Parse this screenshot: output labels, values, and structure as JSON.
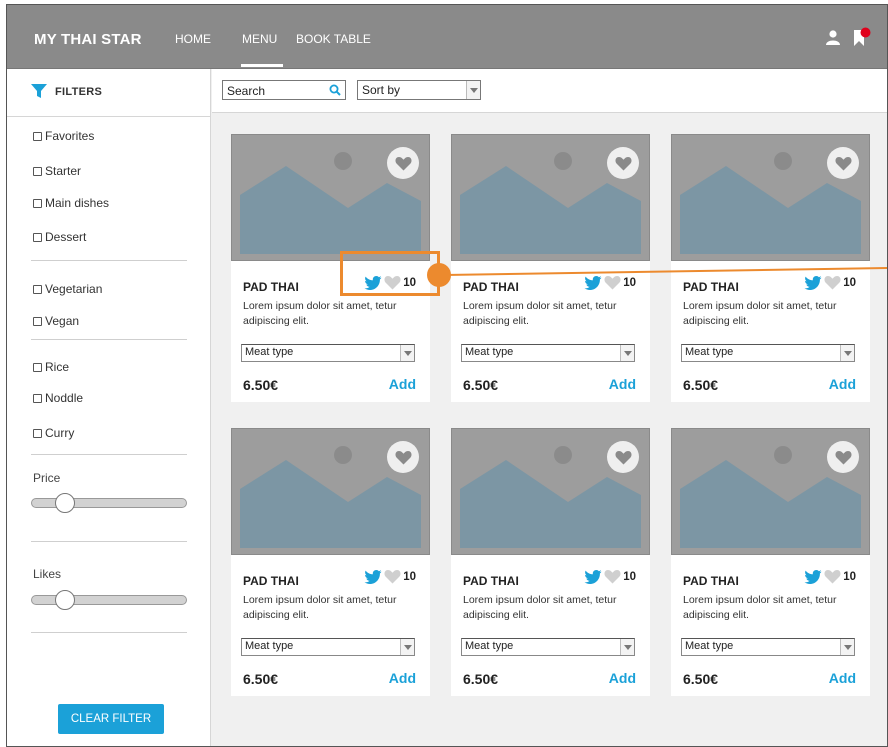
{
  "header": {
    "brand": "MY THAI STAR",
    "nav": [
      "HOME",
      "MENU",
      "BOOK TABLE"
    ],
    "active_nav": "MENU",
    "icons": [
      "user-icon",
      "bookmark-icon"
    ],
    "colors": {
      "header_bg": "#8a8a8a",
      "accent": "#1ba1d8",
      "notification_dot": "#e0001b"
    }
  },
  "sidebar": {
    "filters_title": "FILTERS",
    "groups": [
      [
        "Favorites",
        "Starter",
        "Main dishes",
        "Dessert"
      ],
      [
        "Vegetarian",
        "Vegan"
      ],
      [
        "Rice",
        "Noddle",
        "Curry"
      ]
    ],
    "price_label": "Price",
    "likes_label": "Likes",
    "clear_button": "CLEAR FILTER"
  },
  "toolbar": {
    "search_value": "Search",
    "sort_value": "Sort by"
  },
  "cards": [
    {
      "title": "PAD THAI",
      "likes": "10",
      "desc": "Lorem ipsum dolor sit amet, tetur adipiscing elit.",
      "meat": "Meat type",
      "price": "6.50€",
      "add": "Add"
    },
    {
      "title": "PAD THAI",
      "likes": "10",
      "desc": "Lorem ipsum dolor sit amet, tetur adipiscing elit.",
      "meat": "Meat type",
      "price": "6.50€",
      "add": "Add"
    },
    {
      "title": "PAD THAI",
      "likes": "10",
      "desc": "Lorem ipsum dolor sit amet, tetur adipiscing elit.",
      "meat": "Meat type",
      "price": "6.50€",
      "add": "Add"
    },
    {
      "title": "PAD THAI",
      "likes": "10",
      "desc": "Lorem ipsum dolor sit amet, tetur adipiscing elit.",
      "meat": "Meat type",
      "price": "6.50€",
      "add": "Add"
    },
    {
      "title": "PAD THAI",
      "likes": "10",
      "desc": "Lorem ipsum dolor sit amet, tetur adipiscing elit.",
      "meat": "Meat type",
      "price": "6.50€",
      "add": "Add"
    },
    {
      "title": "PAD THAI",
      "likes": "10",
      "desc": "Lorem ipsum dolor sit amet, tetur adipiscing elit.",
      "meat": "Meat type",
      "price": "6.50€",
      "add": "Add"
    }
  ]
}
